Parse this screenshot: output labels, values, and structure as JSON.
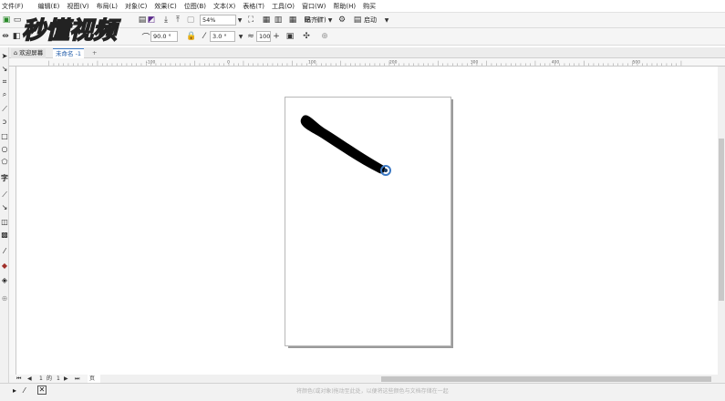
{
  "menubar": {
    "items": [
      "文件(F)",
      "编辑(E)",
      "视图(V)",
      "布局(L)",
      "对象(C)",
      "效果(C)",
      "位图(B)",
      "文本(X)",
      "表格(T)",
      "工具(O)",
      "窗口(W)",
      "帮助(H)",
      "购买"
    ]
  },
  "watermark": {
    "text": "秒懂视频"
  },
  "toolbar1": {
    "zoom_value": "54%",
    "snap_label": "贴齐(T)",
    "launch_label": "启动"
  },
  "toolbar2": {
    "angle_value": "90.0 °",
    "stroke_value": "3.0 °",
    "smooth_value": "100"
  },
  "tabs": {
    "welcome": "欢迎屏幕",
    "document": "未命名 -1",
    "add": "+"
  },
  "pagenav": {
    "current": "1",
    "of_label": "的",
    "total": "1",
    "page_tab": "页 1"
  },
  "status": {
    "hint": "将颜色(或对象)拖动至此处，以便将这些颜色与文档存储在一起"
  },
  "ruler": {
    "labels": [
      "-100",
      "0",
      "100",
      "200",
      "300",
      "400",
      "500"
    ]
  },
  "colors": {
    "accent": "#3c79c4",
    "stroke": "#000000"
  },
  "icons": [
    "new-document-icon",
    "open-icon",
    "save-icon",
    "import-icon",
    "export-icon",
    "fullscreen-icon",
    "options-icon",
    "pick-tool-icon",
    "zoom-tool-icon",
    "freehand-icon",
    "rectangle-icon",
    "ellipse-icon",
    "text-tool-icon",
    "fill-icon"
  ]
}
